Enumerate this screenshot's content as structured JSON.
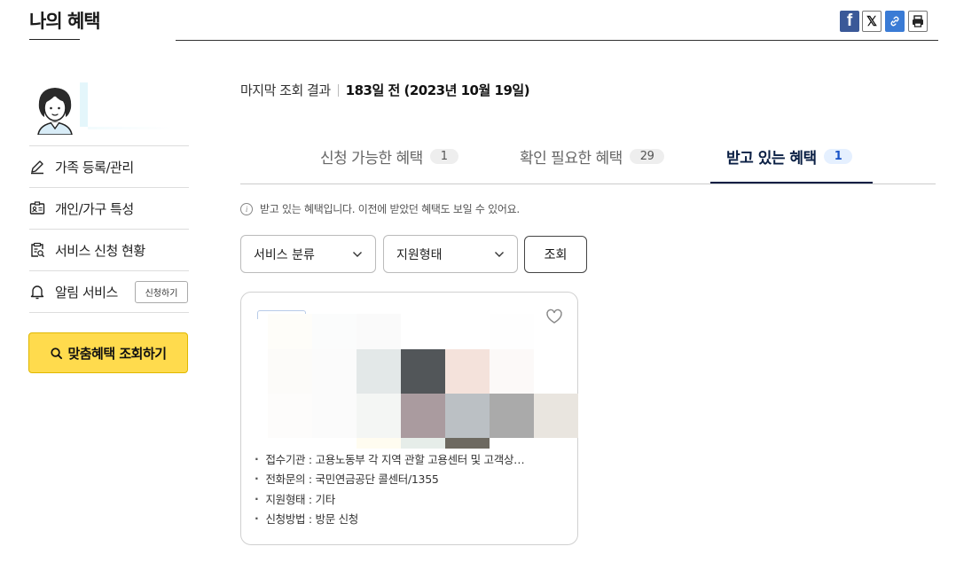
{
  "header": {
    "title": "나의 혜택",
    "share": [
      "facebook-icon",
      "x-icon",
      "link-icon",
      "print-icon"
    ]
  },
  "sidebar": {
    "items": [
      {
        "label": "가족 등록/관리",
        "icon": "pencil-icon"
      },
      {
        "label": "개인/가구 특성",
        "icon": "id-card-icon"
      },
      {
        "label": "서비스 신청 현황",
        "icon": "clipboard-search-icon"
      },
      {
        "label": "알림 서비스",
        "icon": "bell-icon"
      }
    ],
    "notify_button": "신청하기",
    "cta": "맞춤혜택 조회하기"
  },
  "main": {
    "last_query_label": "마지막 조회 결과",
    "last_query_value": "183일 전 (2023년 10월 19일)",
    "tabs": [
      {
        "label": "신청 가능한 혜택",
        "count": "1"
      },
      {
        "label": "확인 필요한 혜택",
        "count": "29"
      },
      {
        "label": "받고 있는 혜택",
        "count": "1"
      }
    ],
    "active_tab": 2,
    "info_note": "받고 있는 혜택입니다. 이전에 받았던 혜택도 보일 수 있어요.",
    "filters": {
      "category": "서비스 분류",
      "support_type": "지원형태",
      "query_button": "조회"
    },
    "card": {
      "details": [
        "접수기관 : 고용노동부 각 지역 관할 고용센터 및 고객상…",
        "전화문의 : 국민연금공단 콜센터/1355",
        "지원형태 : 기타",
        "신청방법 : 방문 신청"
      ]
    }
  },
  "colors": {
    "cta": "#ffdb4d",
    "active_tab": "#0a1f44",
    "active_badge_text": "#1a55c8",
    "facebook": "#3b5998",
    "link": "#3a7bd5"
  }
}
